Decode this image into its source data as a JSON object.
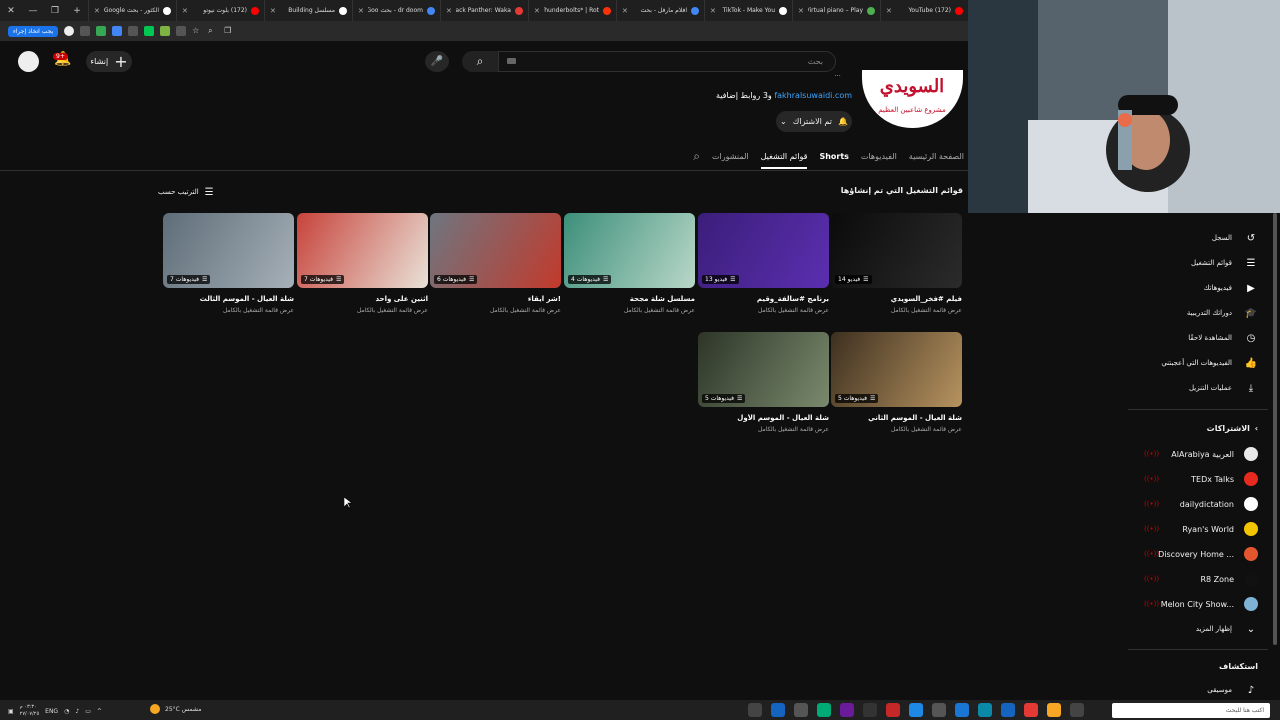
{
  "browser": {
    "tabs": [
      {
        "title": "الكثور - بحث Google",
        "color": "#ffffff"
      },
      {
        "title": "(172) بلوت نيوتو",
        "color": "#ff0000"
      },
      {
        "title": "مسلسل Building",
        "color": "#ffffff"
      },
      {
        "title": "dr doom - بحث Goo",
        "color": "#4285f4"
      },
      {
        "title": "Black Panther: Waka",
        "color": "#e53935"
      },
      {
        "title": "Thunderbolts* | Rot",
        "color": "#fa320a"
      },
      {
        "title": "افلام مارفل - بحث",
        "color": "#4285f4"
      },
      {
        "title": "TikTok - Make You",
        "color": "#ffffff"
      },
      {
        "title": "Virtual piano – Play",
        "color": "#4caf50"
      },
      {
        "title": "(172) YouTube",
        "color": "#ff0000"
      }
    ],
    "toolbar_pill": "يجب اتخاذ إجراء"
  },
  "header": {
    "create_label": "إنشاء",
    "notification_count": "9+",
    "search_placeholder": "بحث"
  },
  "channel": {
    "logo_line1": "السويدي",
    "logo_line2": "مشروع شاعبين العظيم",
    "meta": "... ‏‏ ‏‏ ‏ ‏‏ ‏‏",
    "link_prefix": "و3 روابط إضافية",
    "link": "fakhralsuwaidi.com",
    "subscribed_label": "تم الاشتراك"
  },
  "channel_tabs": {
    "home": "الصفحة الرئيسية",
    "videos": "الفيديوهات",
    "shorts": "Shorts",
    "playlists": "قوائم التشغيل",
    "posts": "المنشورات"
  },
  "section": {
    "title": "قوائم التشغيل التي تم إنشاؤها",
    "sort_label": "الترتيب حسب"
  },
  "playlists": [
    {
      "title": "فيلم #فخر_السويدي",
      "count": "14 فيديو",
      "sub": "عرض قائمة التشغيل بالكامل",
      "colors": [
        "#0b0b0b",
        "#2b2b2b"
      ]
    },
    {
      "title": "برنامج #سالفة_وقيم",
      "count": "13 فيديو",
      "sub": "عرض قائمة التشغيل بالكامل",
      "colors": [
        "#3b1e7a",
        "#5b2fb0"
      ]
    },
    {
      "title": "مسلسل شلة مجحة",
      "count": "4 فيديوهات",
      "sub": "عرض قائمة التشغيل بالكامل",
      "colors": [
        "#3c8f7a",
        "#b9d7c8"
      ]
    },
    {
      "title": "شر ايقاء!",
      "count": "6 فيديوهات",
      "sub": "عرض قائمة التشغيل بالكامل",
      "colors": [
        "#6e7680",
        "#c23a2c"
      ]
    },
    {
      "title": "اثنين على واحد",
      "count": "7 فيديوهات",
      "sub": "عرض قائمة التشغيل بالكامل",
      "colors": [
        "#c7433b",
        "#e9e2d8"
      ]
    },
    {
      "title": "شلة العيال - الموسم الثالث",
      "count": "7 فيديوهات",
      "sub": "عرض قائمة التشغيل بالكامل",
      "colors": [
        "#5e6d78",
        "#a6b0b8"
      ]
    },
    {
      "title": "شلة العيال - الموسم الثاني",
      "count": "5 فيديوهات",
      "sub": "عرض قائمة التشغيل بالكامل",
      "colors": [
        "#3d3020",
        "#b7935f"
      ]
    },
    {
      "title": "شلة العيال - الموسم الأول",
      "count": "5 فيديوهات",
      "sub": "عرض قائمة التشغيل بالكامل",
      "colors": [
        "#2d3528",
        "#7a8a6d"
      ]
    }
  ],
  "sidebar": {
    "you_items": [
      {
        "label": "السجل",
        "icon": "history-icon",
        "glyph": "↺"
      },
      {
        "label": "قوائم التشغيل",
        "icon": "playlists-icon",
        "glyph": "☰"
      },
      {
        "label": "فيديوهاتك",
        "icon": "your-videos-icon",
        "glyph": "▶"
      },
      {
        "label": "دوراتك التدريبية",
        "icon": "courses-icon",
        "glyph": "🎓"
      },
      {
        "label": "المشاهدة لاحقًا",
        "icon": "watch-later-icon",
        "glyph": "◷"
      },
      {
        "label": "الفيديوهات التي أعجبتني",
        "icon": "liked-icon",
        "glyph": "👍"
      },
      {
        "label": "عمليات التنزيل",
        "icon": "download-icon",
        "glyph": "⤓"
      }
    ],
    "subscriptions_title": "الاشتراكات",
    "subscriptions": [
      {
        "label": "AlArabiya العربية",
        "color": "#e9e9e9"
      },
      {
        "label": "TEDx Talks",
        "color": "#e62b1e"
      },
      {
        "label": "dailydictation",
        "color": "#ffffff"
      },
      {
        "label": "Ryan's World",
        "color": "#f2c500"
      },
      {
        "label": "Discovery Home ...",
        "color": "#e4572e"
      },
      {
        "label": "R8 Zone",
        "color": "#111111"
      },
      {
        "label": "Melon City Show...",
        "color": "#7fb3d5"
      }
    ],
    "show_more": "إظهار المزيد",
    "explore_title": "استكشاف",
    "explore_items": [
      {
        "label": "موسيقى",
        "icon": "music-icon",
        "glyph": "♪"
      }
    ]
  },
  "taskbar": {
    "time": "٠٣:٣٠ م",
    "date": "٢٧/٠٧/٢٥",
    "lang": "ENG",
    "weather": "25°C مشمس",
    "search_placeholder": "اكتب هنا للبحث"
  }
}
